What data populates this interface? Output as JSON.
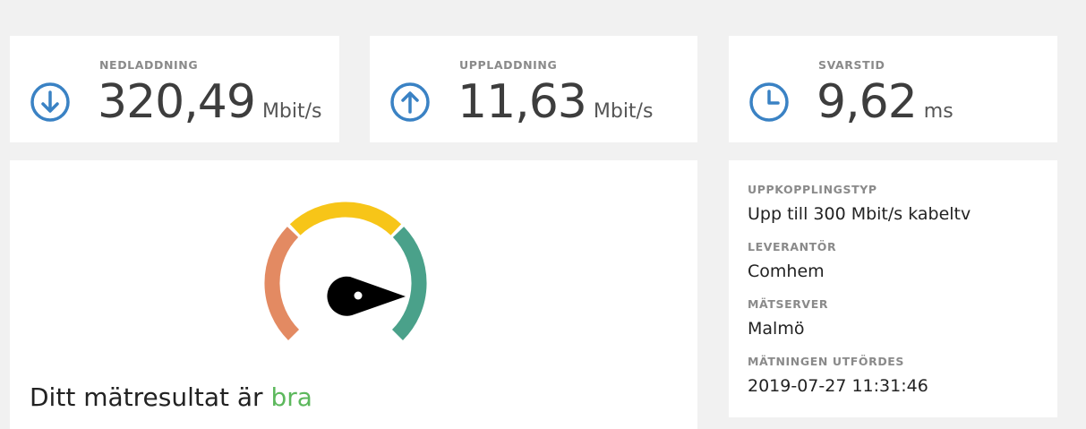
{
  "stats": [
    {
      "label": "NEDLADDNING",
      "value": "320,49",
      "unit": "Mbit/s",
      "icon": "download-arrow-icon"
    },
    {
      "label": "UPPLADDNING",
      "value": "11,63",
      "unit": "Mbit/s",
      "icon": "upload-arrow-icon"
    },
    {
      "label": "SVARSTID",
      "value": "9,62",
      "unit": "ms",
      "icon": "clock-icon"
    }
  ],
  "gauge": {
    "zones": [
      "red-zone",
      "yellow-zone",
      "green-zone"
    ],
    "zone_colors": {
      "red": "#e38a62",
      "yellow": "#f7c518",
      "green": "#4aa18a"
    },
    "needle_color": "#000000"
  },
  "result": {
    "prefix": "Ditt mätresultat är",
    "rating": "bra",
    "rating_color": "#5cb85c"
  },
  "info": {
    "connection_type_label": "UPPKOPPLINGSTYP",
    "connection_type": "Upp till 300 Mbit/s kabeltv",
    "provider_label": "LEVERANTÖR",
    "provider": "Comhem",
    "server_label": "MÄTSERVER",
    "server": "Malmö",
    "performed_label": "MÄTNINGEN UTFÖRDES",
    "performed": "2019-07-27 11:31:46"
  },
  "colors": {
    "accent": "#3a82c4",
    "background": "#f1f1f1",
    "card": "#ffffff"
  }
}
